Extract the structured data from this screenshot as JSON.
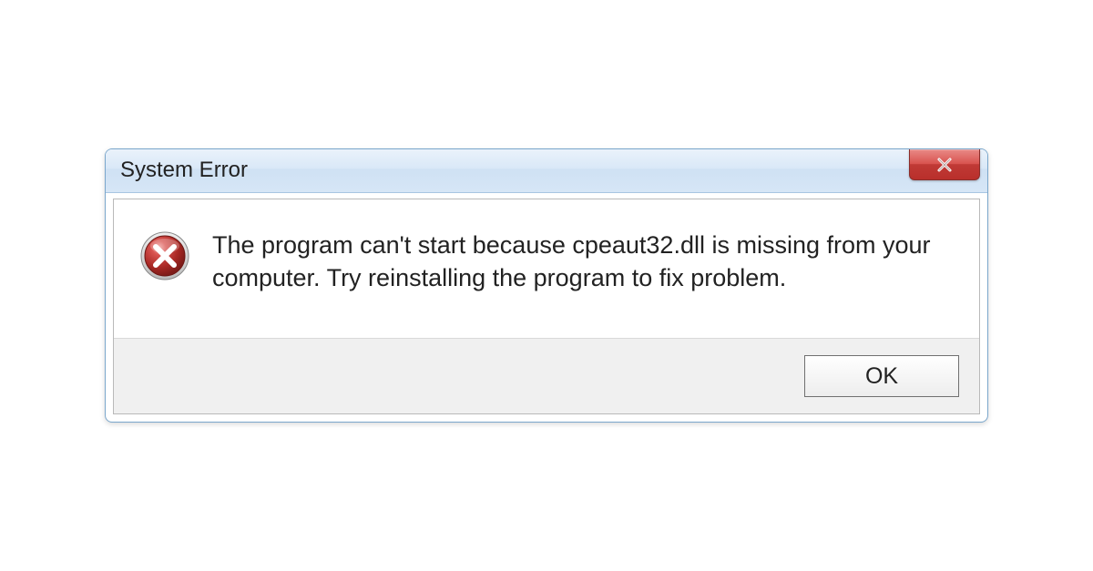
{
  "dialog": {
    "title": "System Error",
    "message": "The program can't start because cpeaut32.dll is missing from your computer. Try reinstalling the program to fix problem.",
    "ok_label": "OK",
    "icon": "error-icon",
    "close_icon": "close-icon",
    "colors": {
      "titlebar_top": "#eaf2fb",
      "titlebar_bottom": "#d6e6f6",
      "close_red": "#c03a36",
      "error_red": "#b92f2b"
    }
  }
}
